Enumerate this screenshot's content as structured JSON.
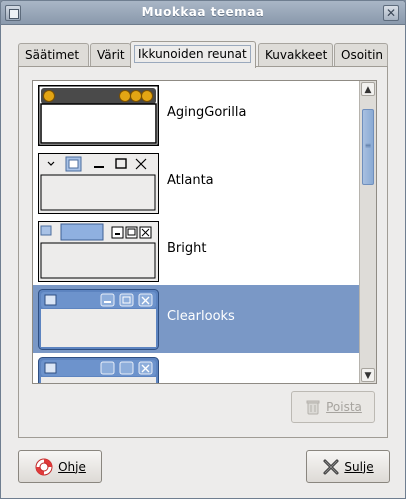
{
  "window": {
    "title": "Muokkaa teemaa"
  },
  "tabs": [
    {
      "label": "Säätimet"
    },
    {
      "label": "Värit"
    },
    {
      "label": "Ikkunoiden reunat"
    },
    {
      "label": "Kuvakkeet"
    },
    {
      "label": "Osoitin"
    }
  ],
  "themes": [
    {
      "name": "AgingGorilla"
    },
    {
      "name": "Atlanta"
    },
    {
      "name": "Bright"
    },
    {
      "name": "Clearlooks"
    }
  ],
  "buttons": {
    "delete": "Poista",
    "help": "Ohje",
    "close": "Sulje"
  },
  "colors": {
    "selection": "#7a98c6",
    "titlebar": "#9aa7b8"
  }
}
